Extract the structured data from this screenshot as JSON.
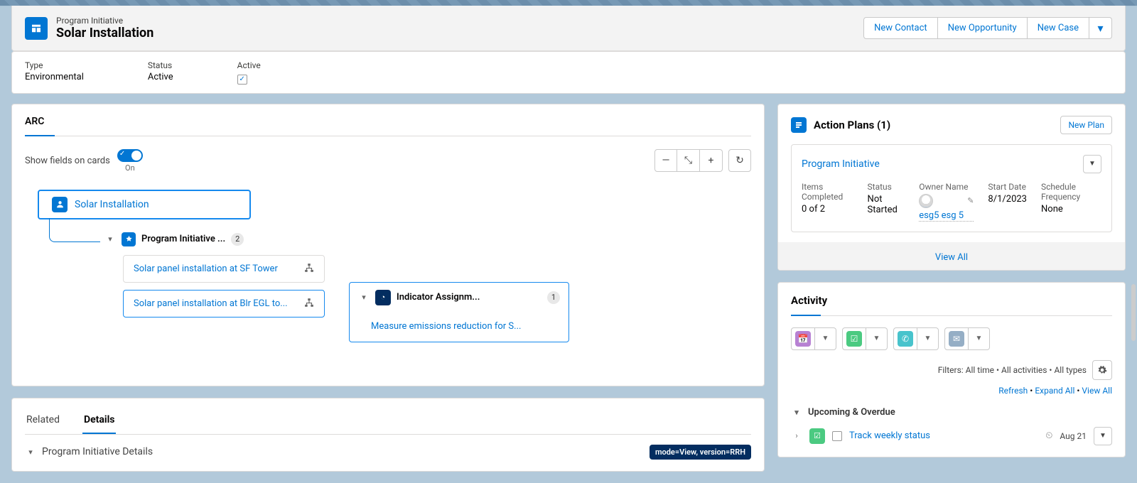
{
  "header": {
    "eyebrow": "Program Initiative",
    "title": "Solar Installation",
    "actions": {
      "newContact": "New Contact",
      "newOpportunity": "New Opportunity",
      "newCase": "New Case"
    }
  },
  "fields": {
    "type": {
      "label": "Type",
      "value": "Environmental"
    },
    "status": {
      "label": "Status",
      "value": "Active"
    },
    "active": {
      "label": "Active",
      "checked": true
    }
  },
  "arc": {
    "title": "ARC",
    "toggleLabel": "Show fields on cards",
    "toggleState": "On",
    "root": {
      "label": "Solar Installation"
    },
    "programInitiative": {
      "label": "Program Initiative ...",
      "count": "2"
    },
    "children": {
      "item1": "Solar panel installation at SF Tower",
      "item2": "Solar panel installation at Blr EGL to..."
    },
    "indicator": {
      "title": "Indicator Assignm...",
      "count": "1",
      "child": "Measure emissions reduction for S..."
    }
  },
  "tabs": {
    "related": "Related",
    "details": "Details",
    "sectionHead": "Program Initiative Details",
    "modeBadge": "mode=View, version=RRH"
  },
  "actionPlans": {
    "title": "Action Plans (1)",
    "newPlan": "New Plan",
    "linkTitle": "Program Initiative",
    "itemsCompleted": {
      "label": "Items Completed",
      "value": "0 of 2"
    },
    "status": {
      "label": "Status",
      "value": "Not Started"
    },
    "owner": {
      "label": "Owner Name",
      "value": "esg5 esg 5"
    },
    "startDate": {
      "label": "Start Date",
      "value": "8/1/2023"
    },
    "schedule": {
      "label": "Schedule Frequency",
      "value": "None"
    },
    "viewAll": "View All"
  },
  "activity": {
    "title": "Activity",
    "filters": "Filters: All time • All activities • All types",
    "refresh": "Refresh",
    "expandAll": "Expand All",
    "viewAll": "View All",
    "upcoming": "Upcoming & Overdue",
    "task": {
      "label": "Track weekly status",
      "date": "Aug 21"
    }
  }
}
